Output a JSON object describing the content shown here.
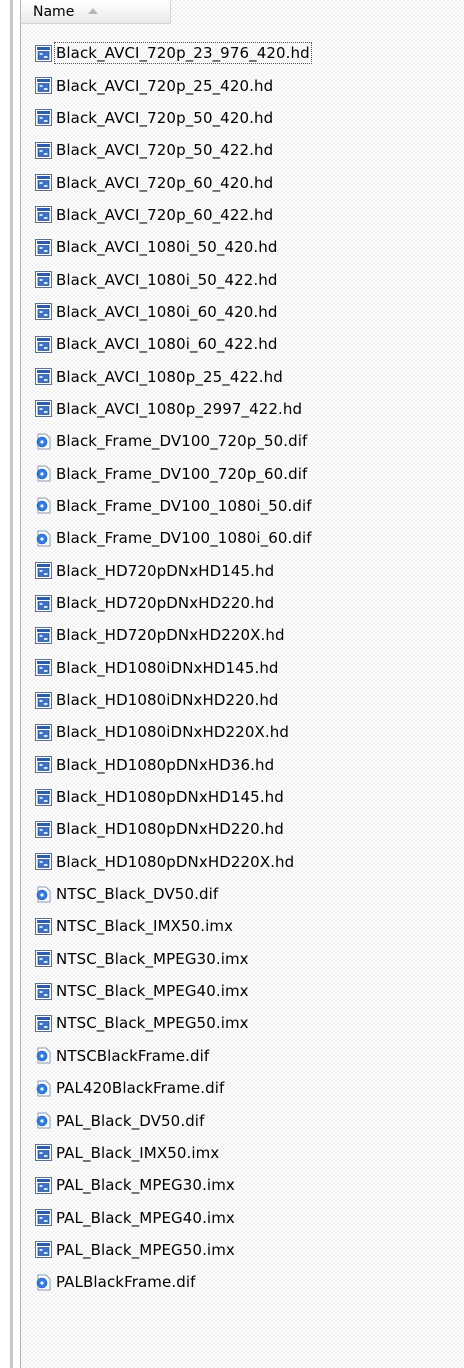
{
  "header": {
    "name_label": "Name"
  },
  "files": [
    {
      "name": "Black_AVCI_720p_23_976_420.hd",
      "icon": "video-file-icon"
    },
    {
      "name": "Black_AVCI_720p_25_420.hd",
      "icon": "video-file-icon"
    },
    {
      "name": "Black_AVCI_720p_50_420.hd",
      "icon": "video-file-icon"
    },
    {
      "name": "Black_AVCI_720p_50_422.hd",
      "icon": "video-file-icon"
    },
    {
      "name": "Black_AVCI_720p_60_420.hd",
      "icon": "video-file-icon"
    },
    {
      "name": "Black_AVCI_720p_60_422.hd",
      "icon": "video-file-icon"
    },
    {
      "name": "Black_AVCI_1080i_50_420.hd",
      "icon": "video-file-icon"
    },
    {
      "name": "Black_AVCI_1080i_50_422.hd",
      "icon": "video-file-icon"
    },
    {
      "name": "Black_AVCI_1080i_60_420.hd",
      "icon": "video-file-icon"
    },
    {
      "name": "Black_AVCI_1080i_60_422.hd",
      "icon": "video-file-icon"
    },
    {
      "name": "Black_AVCI_1080p_25_422.hd",
      "icon": "video-file-icon"
    },
    {
      "name": "Black_AVCI_1080p_2997_422.hd",
      "icon": "video-file-icon"
    },
    {
      "name": "Black_Frame_DV100_720p_50.dif",
      "icon": "media-file-icon"
    },
    {
      "name": "Black_Frame_DV100_720p_60.dif",
      "icon": "media-file-icon"
    },
    {
      "name": "Black_Frame_DV100_1080i_50.dif",
      "icon": "media-file-icon"
    },
    {
      "name": "Black_Frame_DV100_1080i_60.dif",
      "icon": "media-file-icon"
    },
    {
      "name": "Black_HD720pDNxHD145.hd",
      "icon": "video-file-icon"
    },
    {
      "name": "Black_HD720pDNxHD220.hd",
      "icon": "video-file-icon"
    },
    {
      "name": "Black_HD720pDNxHD220X.hd",
      "icon": "video-file-icon"
    },
    {
      "name": "Black_HD1080iDNxHD145.hd",
      "icon": "video-file-icon"
    },
    {
      "name": "Black_HD1080iDNxHD220.hd",
      "icon": "video-file-icon"
    },
    {
      "name": "Black_HD1080iDNxHD220X.hd",
      "icon": "video-file-icon"
    },
    {
      "name": "Black_HD1080pDNxHD36.hd",
      "icon": "video-file-icon"
    },
    {
      "name": "Black_HD1080pDNxHD145.hd",
      "icon": "video-file-icon"
    },
    {
      "name": "Black_HD1080pDNxHD220.hd",
      "icon": "video-file-icon"
    },
    {
      "name": "Black_HD1080pDNxHD220X.hd",
      "icon": "video-file-icon"
    },
    {
      "name": "NTSC_Black_DV50.dif",
      "icon": "media-file-icon"
    },
    {
      "name": "NTSC_Black_IMX50.imx",
      "icon": "video-file-icon"
    },
    {
      "name": "NTSC_Black_MPEG30.imx",
      "icon": "video-file-icon"
    },
    {
      "name": "NTSC_Black_MPEG40.imx",
      "icon": "video-file-icon"
    },
    {
      "name": "NTSC_Black_MPEG50.imx",
      "icon": "video-file-icon"
    },
    {
      "name": "NTSCBlackFrame.dif",
      "icon": "media-file-icon"
    },
    {
      "name": "PAL420BlackFrame.dif",
      "icon": "media-file-icon"
    },
    {
      "name": "PAL_Black_DV50.dif",
      "icon": "media-file-icon"
    },
    {
      "name": "PAL_Black_IMX50.imx",
      "icon": "video-file-icon"
    },
    {
      "name": "PAL_Black_MPEG30.imx",
      "icon": "video-file-icon"
    },
    {
      "name": "PAL_Black_MPEG40.imx",
      "icon": "video-file-icon"
    },
    {
      "name": "PAL_Black_MPEG50.imx",
      "icon": "video-file-icon"
    },
    {
      "name": "PALBlackFrame.dif",
      "icon": "media-file-icon"
    }
  ],
  "colors": {
    "selection_outline": "#555555",
    "video_icon_blue": "#2a5db0",
    "media_icon_blue": "#2f7de1"
  }
}
